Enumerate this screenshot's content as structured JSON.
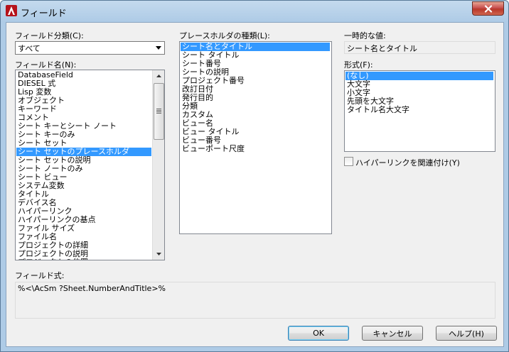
{
  "window": {
    "title": "フィールド",
    "icon": "autocad-a-icon",
    "accent": "#c8102e"
  },
  "field_category": {
    "label": "フィールド分類(C):",
    "selected": "すべて"
  },
  "field_names": {
    "label": "フィールド名(N):",
    "selected_index": 9,
    "items": [
      "DatabaseField",
      "DIESEL 式",
      "Lisp 変数",
      "オブジェクト",
      "キーワード",
      "コメント",
      "シート キーとシート ノート",
      "シート キーのみ",
      "シート セット",
      "シート セットのプレースホルダ",
      "シート セットの説明",
      "シート ノートのみ",
      "シート ビュー",
      "システム変数",
      "タイトル",
      "デバイス名",
      "ハイパーリンク",
      "ハイパーリンクの基点",
      "ファイル サイズ",
      "ファイル名",
      "プロジェクトの詳細",
      "プロジェクトの説明",
      "プロジェクトの位置"
    ]
  },
  "placeholder_types": {
    "label": "プレースホルダの種類(L):",
    "selected_index": 0,
    "items": [
      "シート名とタイトル",
      "シート タイトル",
      "シート番号",
      "シートの説明",
      "プロジェクト番号",
      "改訂日付",
      "発行目的",
      "分類",
      "カスタム",
      "ビュー名",
      "ビュー タイトル",
      "ビュー番号",
      "ビューポート尺度"
    ]
  },
  "temporary_value": {
    "label": "一時的な値:",
    "value": "シート名とタイトル"
  },
  "format": {
    "label": "形式(F):",
    "selected_index": 0,
    "items": [
      "(なし)",
      "大文字",
      "小文字",
      "先頭を大文字",
      "タイトル名大文字"
    ]
  },
  "hyperlink_checkbox": {
    "label": "ハイパーリンクを関連付け(Y)",
    "checked": false
  },
  "field_expression": {
    "label": "フィールド式:",
    "value": "%<\\AcSm ?Sheet.NumberAndTitle>%"
  },
  "buttons": {
    "ok": "OK",
    "cancel": "キャンセル",
    "help": "ヘルプ(H)"
  }
}
